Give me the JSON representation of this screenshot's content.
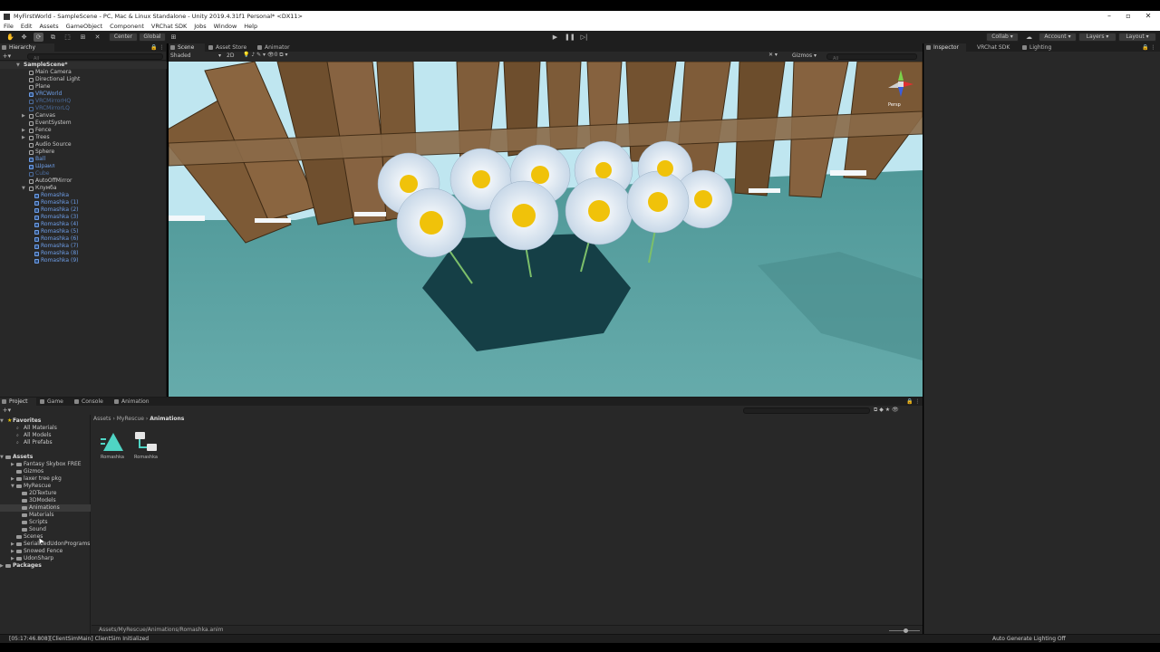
{
  "window": {
    "title": "MyFirstWorld - SampleScene - PC, Mac & Linux Standalone - Unity 2019.4.31f1 Personal* <DX11>"
  },
  "menu": [
    "File",
    "Edit",
    "Assets",
    "GameObject",
    "Component",
    "VRChat SDK",
    "Jobs",
    "Window",
    "Help"
  ],
  "toolbar": {
    "pivot_label": "Center",
    "global_label": "Global",
    "collab_label": "Collab",
    "account_label": "Account",
    "layers_label": "Layers",
    "layout_label": "Layout"
  },
  "hierarchy": {
    "tab": "Hierarchy",
    "search_placeholder": "All",
    "scene": "SampleScene*",
    "items": [
      {
        "label": "Main Camera"
      },
      {
        "label": "Directional Light"
      },
      {
        "label": "Plane"
      },
      {
        "label": "VRCWorld"
      },
      {
        "label": "VRCMirrorHQ"
      },
      {
        "label": "VRCMirrorLQ"
      },
      {
        "label": "Canvas"
      },
      {
        "label": "EventSystem"
      },
      {
        "label": "Fence"
      },
      {
        "label": "Trees"
      },
      {
        "label": "Audio Source"
      },
      {
        "label": "Sphere"
      },
      {
        "label": "Ball"
      },
      {
        "label": "Шраил"
      },
      {
        "label": "Cube"
      },
      {
        "label": "AutoOffMirror"
      },
      {
        "label": "Клумба"
      },
      {
        "label": "Romashka"
      },
      {
        "label": "Romashka (1)"
      },
      {
        "label": "Romashka (2)"
      },
      {
        "label": "Romashka (3)"
      },
      {
        "label": "Romashka (4)"
      },
      {
        "label": "Romashka (5)"
      },
      {
        "label": "Romashka (6)"
      },
      {
        "label": "Romashka (7)"
      },
      {
        "label": "Romashka (8)"
      },
      {
        "label": "Romashka (9)"
      }
    ]
  },
  "scene": {
    "tabs": [
      "Scene",
      "Asset Store",
      "Animator"
    ],
    "shading_mode": "Shaded",
    "mode_2d": "2D",
    "gizmos_label": "Gizmos",
    "search_placeholder": "All",
    "gizmo_label": "Persp"
  },
  "inspector": {
    "tabs": [
      "Inspector",
      "VRChat SDK",
      "Lighting"
    ]
  },
  "project": {
    "tabs": [
      "Project",
      "Game",
      "Console",
      "Animation"
    ],
    "favorites": {
      "header": "Favorites",
      "items": [
        "All Materials",
        "All Models",
        "All Prefabs"
      ]
    },
    "assets_header": "Assets",
    "folders": [
      "Fantasy Skybox FREE",
      "Gizmos",
      "laxer tree pkg",
      "MyRescue",
      "2DTexture",
      "3DModels",
      "Animations",
      "Materials",
      "Scripts",
      "Sound",
      "Scenes",
      "SerializedUdonPrograms",
      "Snowed Fence",
      "UdonSharp"
    ],
    "packages_header": "Packages",
    "breadcrumb": [
      "Assets",
      "MyRescue",
      "Animations"
    ],
    "assets": [
      {
        "name": "Romashka",
        "icon": "animation-clip-icon"
      },
      {
        "name": "Romashka",
        "icon": "animator-controller-icon"
      }
    ],
    "selected_path": "Assets/MyRescue/Animations/Romashka.anim"
  },
  "status": {
    "message": "[05:17:46.808][ClientSimMain] ClientSim Initialized",
    "lighting": "Auto Generate Lighting Off"
  },
  "colors": {
    "editor_bg": "#282828",
    "prefab_blue": "#6e9ee8",
    "ground": "#5fa5a5",
    "sky": "#bfe6f0",
    "fence": "#7a5a36"
  }
}
